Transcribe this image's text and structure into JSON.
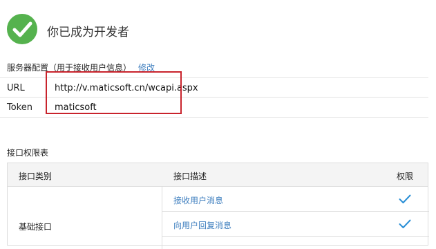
{
  "status": {
    "icon": "check-circle-icon",
    "title": "你已成为开发者"
  },
  "server_config": {
    "heading": "服务器配置（用于接收用户信息）",
    "edit_label": "修改",
    "url_label": "URL",
    "url_value": "http://v.maticsoft.cn/wcapi.aspx",
    "token_label": "Token",
    "token_value": "maticsoft"
  },
  "permissions": {
    "heading": "接口权限表",
    "columns": [
      "接口类别",
      "接口描述",
      "权限"
    ],
    "group": "基础接口",
    "rows": [
      {
        "desc": "接收用户消息",
        "permission_icon": "check-icon"
      },
      {
        "desc": "向用户回复消息",
        "permission_icon": "check-icon"
      }
    ]
  },
  "colors": {
    "success": "#55b24e",
    "link": "#3f7fbf",
    "highlight": "#c8232c",
    "check": "#2a8fd6"
  }
}
